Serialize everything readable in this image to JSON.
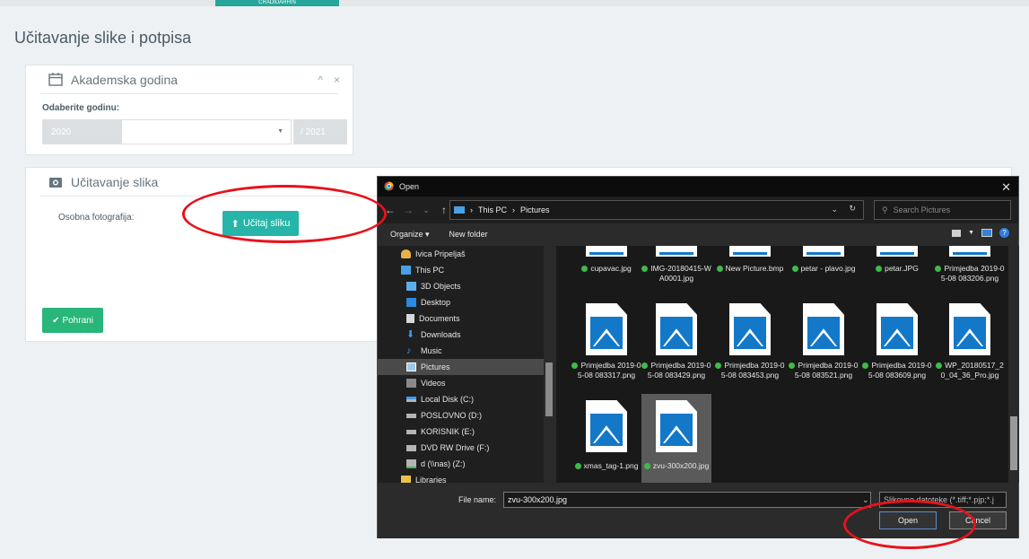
{
  "page": {
    "tab_label": "CRADIDARHIN",
    "title": "Učitavanje slike i potpisa"
  },
  "academic_panel": {
    "title": "Akademska godina",
    "collapse_icon": "^",
    "close_icon": "×",
    "select_label": "Odaberite godinu:",
    "year_from": "2020",
    "year_to": "/ 2021"
  },
  "upload_panel": {
    "title": "Učitavanje slika",
    "photo_label": "Osobna fotografija:",
    "upload_button": "Učitaj sliku",
    "save_button": "Pohrani"
  },
  "dialog": {
    "title": "Open",
    "breadcrumb": [
      "This PC",
      "Pictures"
    ],
    "search_placeholder": "Search Pictures",
    "organize": "Organize ▾",
    "new_folder": "New folder",
    "nav_items": [
      {
        "label": "Ivica Pripeljaš",
        "icon": "user-icon"
      },
      {
        "label": "This PC",
        "icon": "pc-icon"
      },
      {
        "label": "3D Objects",
        "icon": "cube-icon"
      },
      {
        "label": "Desktop",
        "icon": "desktop-icon"
      },
      {
        "label": "Documents",
        "icon": "document-icon"
      },
      {
        "label": "Downloads",
        "icon": "download-icon"
      },
      {
        "label": "Music",
        "icon": "music-icon"
      },
      {
        "label": "Pictures",
        "icon": "pictures-icon"
      },
      {
        "label": "Videos",
        "icon": "video-icon"
      },
      {
        "label": "Local Disk (C:)",
        "icon": "drive-icon"
      },
      {
        "label": "POSLOVNO (D:)",
        "icon": "drive-icon"
      },
      {
        "label": "KORISNIK (E:)",
        "icon": "drive-icon"
      },
      {
        "label": "DVD RW Drive (F:)",
        "icon": "dvd-icon"
      },
      {
        "label": "d (\\\\nas) (Z:)",
        "icon": "network-drive-icon"
      },
      {
        "label": "Libraries",
        "icon": "library-icon"
      }
    ],
    "files": [
      {
        "name": "cupavac.jpg"
      },
      {
        "name": "IMG-20180415-WA0001.jpg"
      },
      {
        "name": "New Picture.bmp"
      },
      {
        "name": "petar - plavo.jpg"
      },
      {
        "name": "petar.JPG"
      },
      {
        "name": "Primjedba 2019-05-08 083206.png"
      },
      {
        "name": "Primjedba 2019-05-08 083317.png"
      },
      {
        "name": "Primjedba 2019-05-08 083429.png"
      },
      {
        "name": "Primjedba 2019-05-08 083453.png"
      },
      {
        "name": "Primjedba 2019-05-08 083521.png"
      },
      {
        "name": "Primjedba 2019-05-08 083609.png"
      },
      {
        "name": "WP_20180517_20_04_36_Pro.jpg"
      },
      {
        "name": "xmas_tag-1.png"
      },
      {
        "name": "zvu-300x200.jpg"
      }
    ],
    "file_name_label": "File name:",
    "file_name_value": "zvu-300x200.jpg",
    "filter_value": "Slikovne datoteke (*.tiff;*.pjp;*.j",
    "open_button": "Open",
    "cancel_button": "Cancel"
  }
}
